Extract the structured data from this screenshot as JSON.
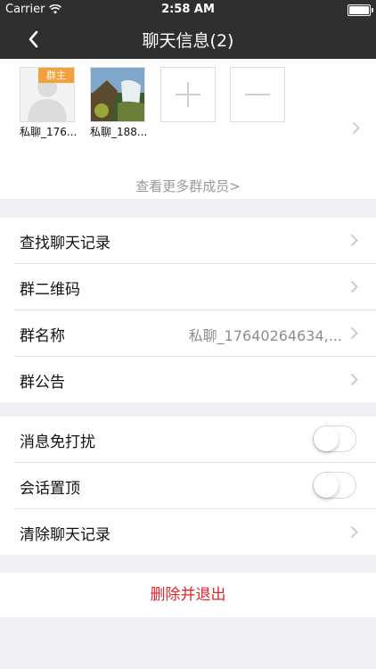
{
  "status_bar": {
    "carrier": "Carrier",
    "time": "2:58 AM"
  },
  "nav": {
    "title": "聊天信息(2)"
  },
  "members": {
    "items": [
      {
        "name": "私聊_176...",
        "badge": "群主"
      },
      {
        "name": "私聊_188..."
      }
    ],
    "more_label": "查看更多群成员>"
  },
  "group1": [
    {
      "label": "查找聊天记录"
    },
    {
      "label": "群二维码"
    },
    {
      "label": "群名称",
      "value": "私聊_17640264634,..."
    },
    {
      "label": "群公告"
    }
  ],
  "group2": [
    {
      "label": "消息免打扰",
      "switch_on": false
    },
    {
      "label": "会话置顶",
      "switch_on": false
    },
    {
      "label": "清除聊天记录"
    }
  ],
  "danger_label": "删除并退出",
  "colors": {
    "nav_bg": "#2f2f2f",
    "badge": "#f5a13b",
    "danger": "#e0242b",
    "page_bg": "#efeff4"
  }
}
